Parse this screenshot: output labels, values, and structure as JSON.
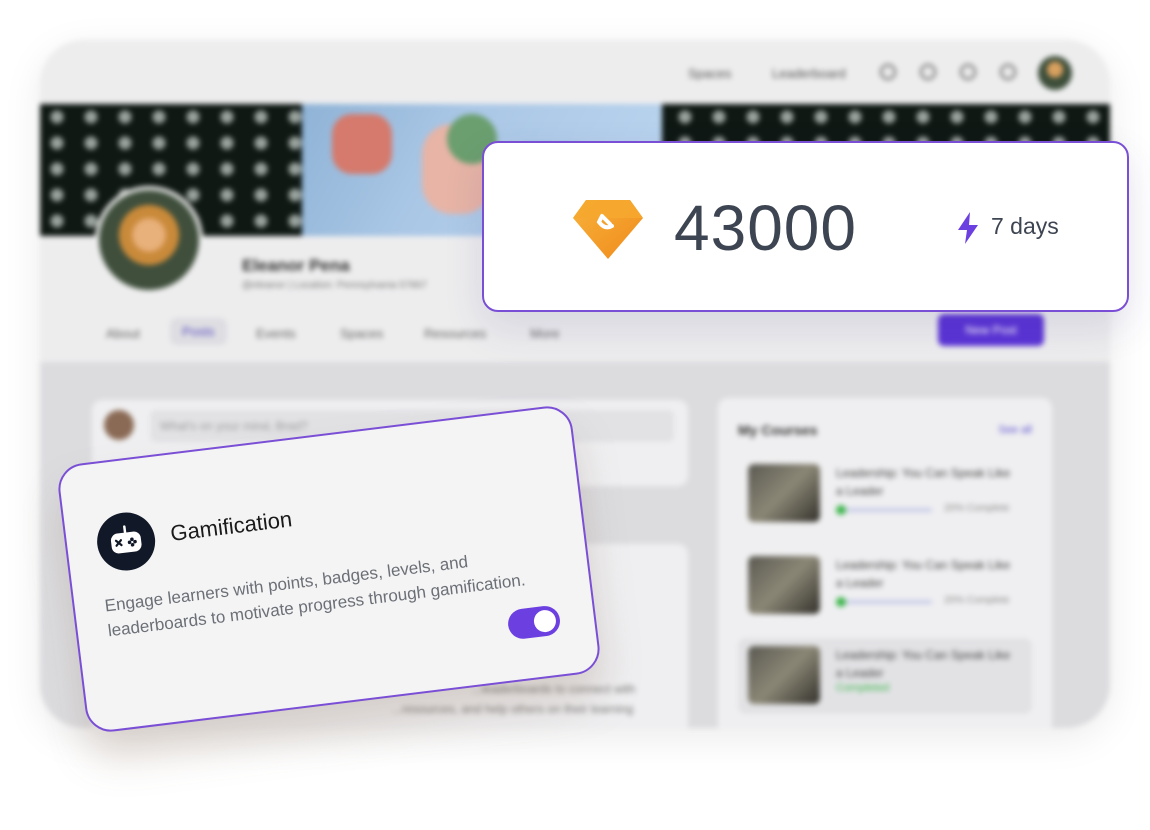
{
  "topbar": {
    "nav": [
      "Spaces",
      "Leaderboard"
    ]
  },
  "profile": {
    "name": "Eleanor Pena",
    "meta": "@eleanor | Location: Pennsylvania 57867",
    "tabs": [
      "About",
      "Posts",
      "Events",
      "Spaces",
      "Resources",
      "More"
    ],
    "new_post": "New Post"
  },
  "composer": {
    "placeholder": "What's on your mind, Brad?"
  },
  "feed": {
    "lines": [
      "...leaderboards to connect with",
      "...resources, and help others on their learning"
    ]
  },
  "courses": {
    "title": "My Courses",
    "see_all": "See all",
    "items": [
      {
        "title": "Leadership: You Can Speak Like a Leader",
        "progress": "20% Complete",
        "percent": 20
      },
      {
        "title": "Leadership: You Can Speak Like a Leader",
        "progress": "20% Complete",
        "percent": 20
      },
      {
        "title": "Leadership: You Can Speak Like a Leader",
        "progress": "Completed",
        "percent": 100
      }
    ]
  },
  "points_card": {
    "value": "43000",
    "streak": "7 days",
    "icons": [
      "gem-icon",
      "bolt-icon"
    ],
    "colors": {
      "gem": "#f59a23",
      "bolt": "#6c3fe0",
      "border": "#7a4fd6"
    }
  },
  "gamification": {
    "title": "Gamification",
    "description": "Engage learners with points, badges, levels, and leaderboards to motivate progress through gamification.",
    "enabled": true,
    "icon": "gamepad-icon",
    "toggle_color": "#6c3fe0"
  }
}
